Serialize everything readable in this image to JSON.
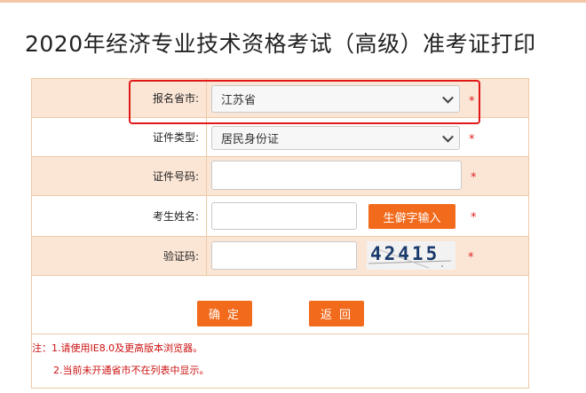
{
  "page": {
    "title": "2020年经济专业技术资格考试（高级）准考证打印"
  },
  "form": {
    "province": {
      "label": "报名省市:",
      "value": "江苏省",
      "required": "*"
    },
    "id_type": {
      "label": "证件类型:",
      "value": "居民身份证",
      "required": "*"
    },
    "id_number": {
      "label": "证件号码:",
      "value": "",
      "required": "*"
    },
    "name": {
      "label": "考生姓名:",
      "value": "",
      "rare_char_button": "生僻字输入",
      "required": "*"
    },
    "captcha": {
      "label": "验证码:",
      "value": "",
      "image_text": "42415",
      "required": "*"
    }
  },
  "actions": {
    "confirm": "确 定",
    "back": "返 回"
  },
  "notes": {
    "line1": "注：1.请使用IE8.0及更高版本浏览器。",
    "line2": "2.当前未开通省市不在列表中显示。"
  },
  "colors": {
    "accent": "#f26a1b",
    "row_shade": "#fbe6d6",
    "border": "#f0c9a5",
    "highlight": "#e01818",
    "required": "#e02020"
  }
}
